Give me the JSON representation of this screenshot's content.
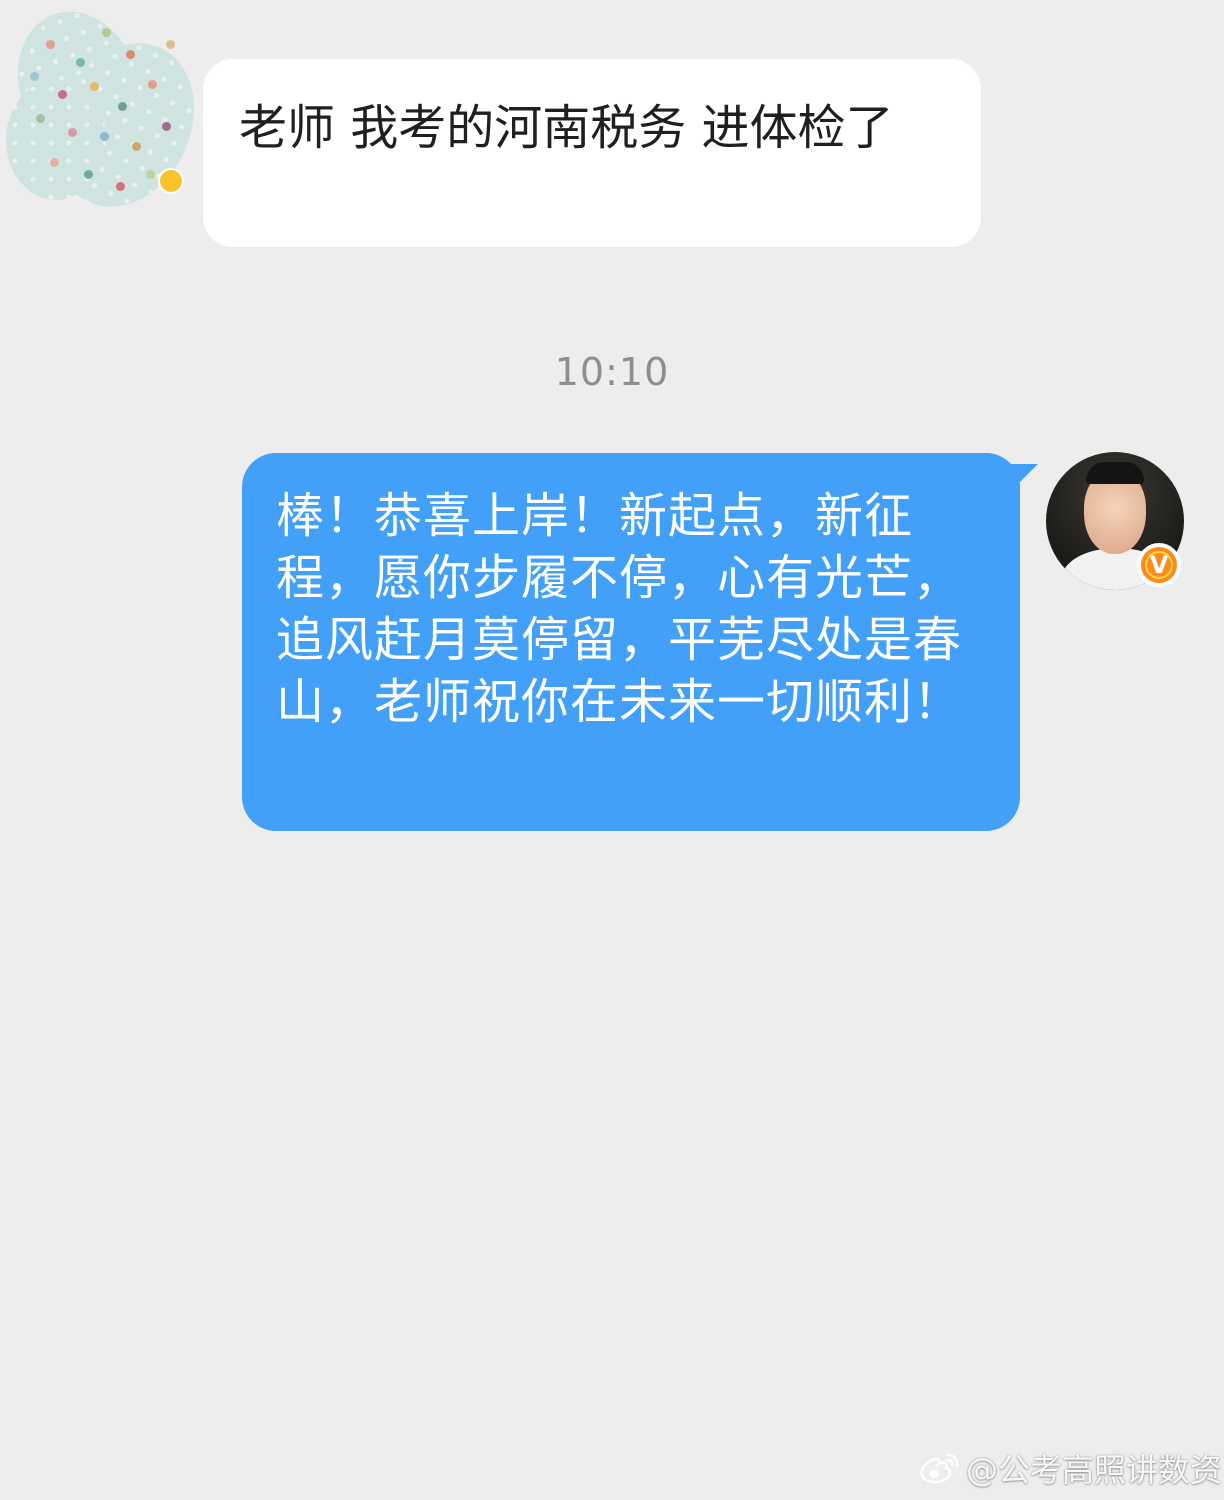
{
  "messages": [
    {
      "direction": "incoming",
      "text": "老师 我考的河南税务 进体检了"
    },
    {
      "direction": "outgoing",
      "text": "棒！恭喜上岸！新起点，新征程，愿你步履不停，心有光芒，追风赶月莫停留，平芜尽处是春山，老师祝你在未来一切顺利！"
    }
  ],
  "timestamp": "10:10",
  "verified_badge": "V",
  "watermark": {
    "icon": "weibo-icon",
    "text": "@公考高照讲数资"
  },
  "colors": {
    "background": "#ededed",
    "incoming_bubble": "#ffffff",
    "outgoing_bubble": "#42a0f8",
    "timestamp": "#8e8e8e",
    "verified_badge": "#ff8a1c"
  }
}
